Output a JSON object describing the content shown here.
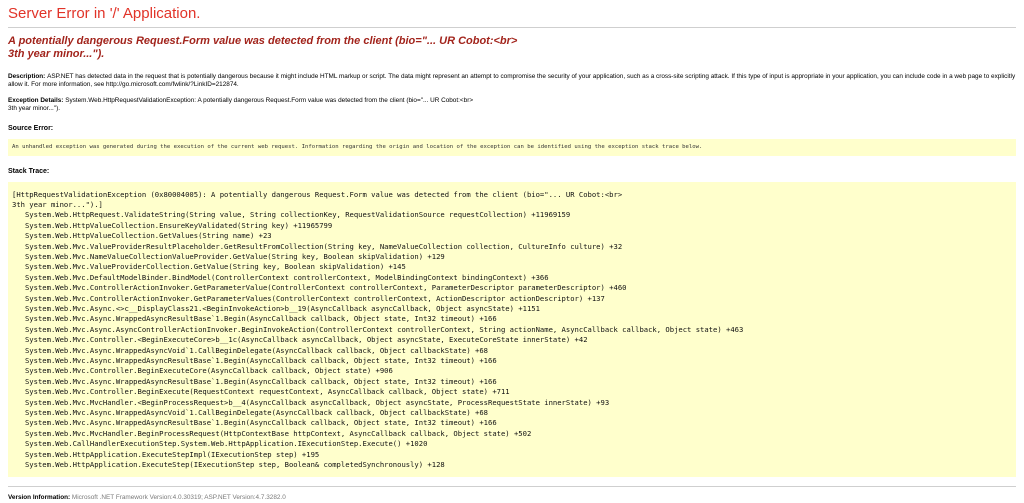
{
  "page": {
    "title": "Server Error in '/' Application.",
    "subtitle": "A potentially dangerous Request.Form value was detected from the client (bio=\"... UR Cobot:<br>\n3th year minor...\").",
    "description_label": "Description: ",
    "description": "ASP.NET has detected data in the request that is potentially dangerous because it might include HTML markup or script. The data might represent an attempt to compromise the security of your application, such as a cross-site scripting attack. If this type of input is appropriate in your application, you can include code in a web page to explicitly allow it. For more information, see http://go.microsoft.com/fwlink/?LinkID=212874.",
    "exception_details_label": "Exception Details: ",
    "exception_details": "System.Web.HttpRequestValidationException: A potentially dangerous Request.Form value was detected from the client (bio=\"... UR Cobot:<br>\n3th year minor...\").",
    "source_error_label": "Source Error:",
    "source_error_text": "An unhandled exception was generated during the execution of the current web request. Information regarding the origin and location of the exception can be identified using the exception stack trace below.",
    "stack_trace_label": "Stack Trace:",
    "stack_trace_lines": [
      "[HttpRequestValidationException (0x80004005): A potentially dangerous Request.Form value was detected from the client (bio=\"... UR Cobot:<br>",
      "3th year minor...\").]",
      "   System.Web.HttpRequest.ValidateString(String value, String collectionKey, RequestValidationSource requestCollection) +11969159",
      "   System.Web.HttpValueCollection.EnsureKeyValidated(String key) +11965799",
      "   System.Web.HttpValueCollection.GetValues(String name) +23",
      "   System.Web.Mvc.ValueProviderResultPlaceholder.GetResultFromCollection(String key, NameValueCollection collection, CultureInfo culture) +32",
      "   System.Web.Mvc.NameValueCollectionValueProvider.GetValue(String key, Boolean skipValidation) +129",
      "   System.Web.Mvc.ValueProviderCollection.GetValue(String key, Boolean skipValidation) +145",
      "   System.Web.Mvc.DefaultModelBinder.BindModel(ControllerContext controllerContext, ModelBindingContext bindingContext) +366",
      "   System.Web.Mvc.ControllerActionInvoker.GetParameterValue(ControllerContext controllerContext, ParameterDescriptor parameterDescriptor) +460",
      "   System.Web.Mvc.ControllerActionInvoker.GetParameterValues(ControllerContext controllerContext, ActionDescriptor actionDescriptor) +137",
      "   System.Web.Mvc.Async.<>c__DisplayClass21.<BeginInvokeAction>b__19(AsyncCallback asyncCallback, Object asyncState) +1151",
      "   System.Web.Mvc.Async.WrappedAsyncResultBase`1.Begin(AsyncCallback callback, Object state, Int32 timeout) +166",
      "   System.Web.Mvc.Async.AsyncControllerActionInvoker.BeginInvokeAction(ControllerContext controllerContext, String actionName, AsyncCallback callback, Object state) +463",
      "   System.Web.Mvc.Controller.<BeginExecuteCore>b__1c(AsyncCallback asyncCallback, Object asyncState, ExecuteCoreState innerState) +42",
      "   System.Web.Mvc.Async.WrappedAsyncVoid`1.CallBeginDelegate(AsyncCallback callback, Object callbackState) +68",
      "   System.Web.Mvc.Async.WrappedAsyncResultBase`1.Begin(AsyncCallback callback, Object state, Int32 timeout) +166",
      "   System.Web.Mvc.Controller.BeginExecuteCore(AsyncCallback callback, Object state) +906",
      "   System.Web.Mvc.Async.WrappedAsyncResultBase`1.Begin(AsyncCallback callback, Object state, Int32 timeout) +166",
      "   System.Web.Mvc.Controller.BeginExecute(RequestContext requestContext, AsyncCallback callback, Object state) +711",
      "   System.Web.Mvc.MvcHandler.<BeginProcessRequest>b__4(AsyncCallback asyncCallback, Object asyncState, ProcessRequestState innerState) +93",
      "   System.Web.Mvc.Async.WrappedAsyncVoid`1.CallBeginDelegate(AsyncCallback callback, Object callbackState) +68",
      "   System.Web.Mvc.Async.WrappedAsyncResultBase`1.Begin(AsyncCallback callback, Object state, Int32 timeout) +166",
      "   System.Web.Mvc.MvcHandler.BeginProcessRequest(HttpContextBase httpContext, AsyncCallback callback, Object state) +502",
      "   System.Web.CallHandlerExecutionStep.System.Web.HttpApplication.IExecutionStep.Execute() +1020",
      "   System.Web.HttpApplication.ExecuteStepImpl(IExecutionStep step) +195",
      "   System.Web.HttpApplication.ExecuteStep(IExecutionStep step, Boolean& completedSynchronously) +128"
    ],
    "version_label": "Version Information: ",
    "version_text": "Microsoft .NET Framework Version:4.0.30319; ASP.NET Version:4.7.3282.0",
    "colors": {
      "header_red": "#e13328",
      "subtitle_maroon": "#a2241c",
      "code_background": "#ffffcc",
      "divider_silver": "#cfcfcf",
      "version_gray": "#7a7a7a"
    }
  }
}
